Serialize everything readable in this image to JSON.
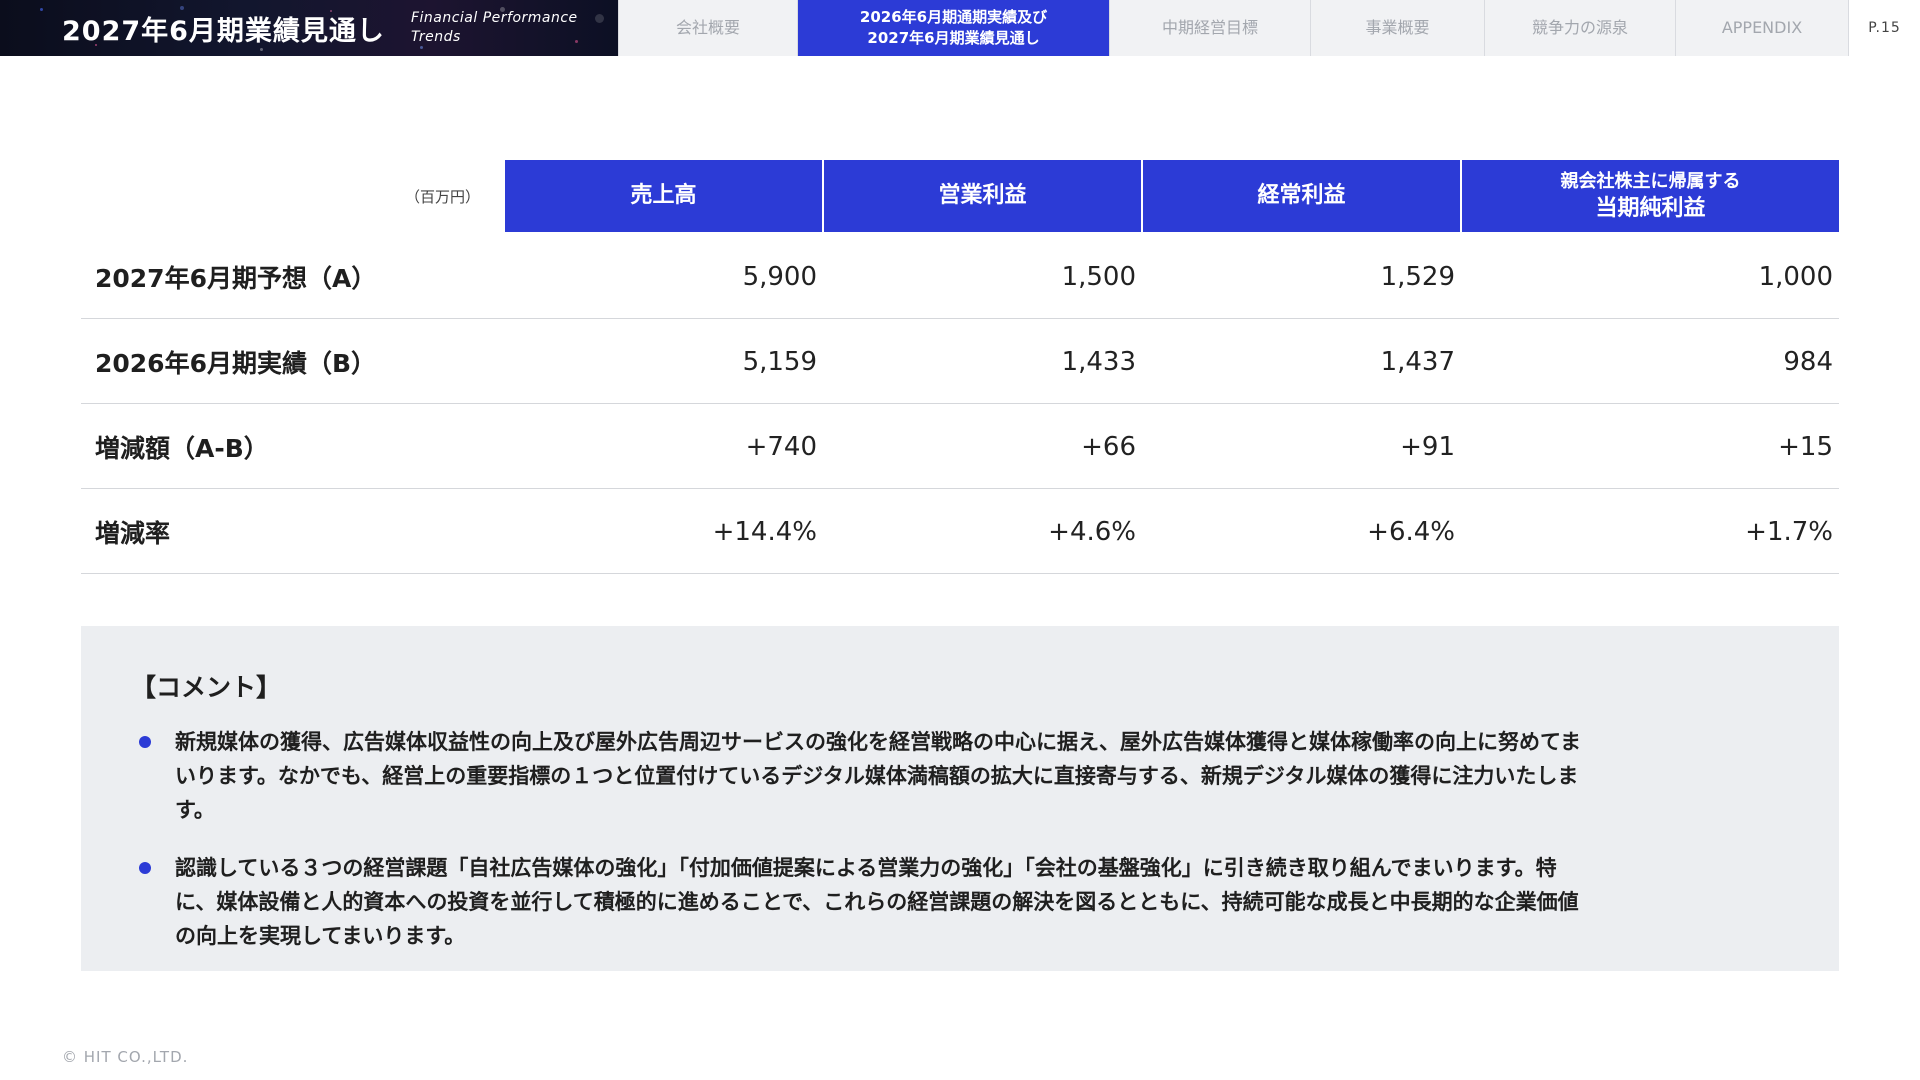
{
  "header": {
    "title": "2027年6月期業績見通し",
    "subtitle_line1": "Financial Performance",
    "subtitle_line2": "Trends",
    "tabs": [
      {
        "label": "会社概要"
      },
      {
        "label_line1": "2026年6月期通期実績及び",
        "label_line2": "2027年6月期業績見通し"
      },
      {
        "label": "中期経営目標"
      },
      {
        "label": "事業概要"
      },
      {
        "label": "競争力の源泉"
      },
      {
        "label": "APPENDIX"
      }
    ],
    "active_tab_index": 1,
    "page_number": "P.15"
  },
  "table": {
    "unit": "（百万円）",
    "columns": [
      {
        "label": "売上高"
      },
      {
        "label": "営業利益"
      },
      {
        "label": "経常利益"
      },
      {
        "label_line1": "親会社株主に帰属する",
        "label_line2": "当期純利益"
      }
    ],
    "rows": [
      {
        "label": "2027年6月期予想（A）",
        "values": [
          "5,900",
          "1,500",
          "1,529",
          "1,000"
        ]
      },
      {
        "label": "2026年6月期実績（B）",
        "values": [
          "5,159",
          "1,433",
          "1,437",
          "984"
        ]
      },
      {
        "label": "増減額（A-B）",
        "values": [
          "+740",
          "+66",
          "+91",
          "+15"
        ]
      },
      {
        "label": "増減率",
        "values": [
          "+14.4%",
          "+4.6%",
          "+6.4%",
          "+1.7%"
        ]
      }
    ]
  },
  "comment": {
    "title": "【コメント】",
    "bullets": [
      {
        "line1": "新規媒体の獲得、広告媒体収益性の向上及び屋外広告周辺サービスの強化を経営戦略の中心に据え、屋外広告媒体獲得と媒体稼働率の向上に努めてま",
        "line2": "いります。なかでも、経営上の重要指標の１つと位置付けているデジタル媒体満稿額の拡大に直接寄与する、新規デジタル媒体の獲得に注力いたしま",
        "line3": "す。"
      },
      {
        "line1": "認識している３つの経営課題「自社広告媒体の強化」「付加価値提案による営業力の強化」「会社の基盤強化」に引き続き取り組んでまいります。特",
        "line2": "に、媒体設備と人的資本への投資を並行して積極的に進めることで、これらの経営課題の解決を図るとともに、持続可能な成長と中長期的な企業価値",
        "line3": "の向上を実現してまいります。"
      }
    ]
  },
  "footer": "© HIT CO.,LTD.",
  "colors": {
    "accent": "#2c3bd6",
    "header_dark": "#0b0d1c",
    "tab_inactive_bg": "#f1f2f4",
    "tab_inactive_text": "#a3a7ae",
    "comment_bg": "#eceef1"
  }
}
